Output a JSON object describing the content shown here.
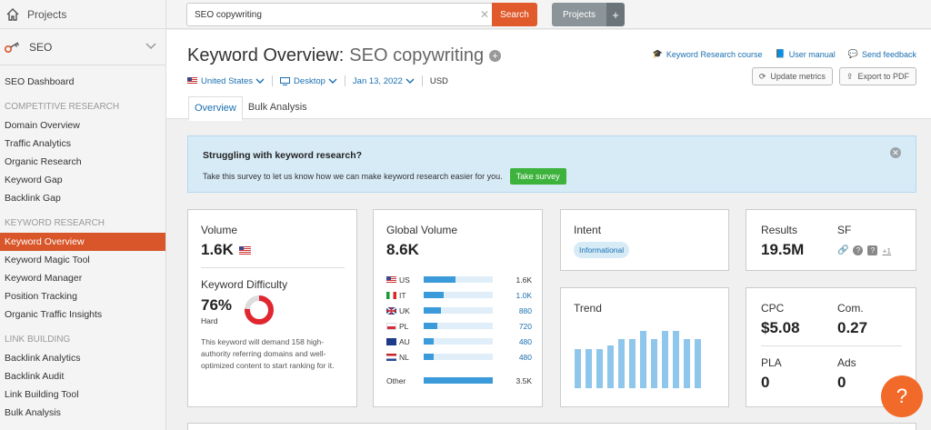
{
  "sidebar": {
    "projects_label": "Projects",
    "seo_label": "SEO",
    "dashboard": "SEO Dashboard",
    "sections": [
      {
        "heading": "COMPETITIVE RESEARCH",
        "items": [
          "Domain Overview",
          "Traffic Analytics",
          "Organic Research",
          "Keyword Gap",
          "Backlink Gap"
        ]
      },
      {
        "heading": "KEYWORD RESEARCH",
        "items": [
          "Keyword Overview",
          "Keyword Magic Tool",
          "Keyword Manager",
          "Position Tracking",
          "Organic Traffic Insights"
        ]
      },
      {
        "heading": "LINK BUILDING",
        "items": [
          "Backlink Analytics",
          "Backlink Audit",
          "Link Building Tool",
          "Bulk Analysis"
        ]
      }
    ]
  },
  "topbar": {
    "search_value": "SEO copywriting",
    "search_button": "Search",
    "projects_button": "Projects",
    "projects_plus": "+"
  },
  "header": {
    "title_prefix": "Keyword Overview:",
    "keyword": "SEO copywriting",
    "filters": {
      "country": "United States",
      "device": "Desktop",
      "date": "Jan 13, 2022",
      "currency": "USD"
    },
    "links": [
      "Keyword Research course",
      "User manual",
      "Send feedback"
    ],
    "buttons": [
      "Update metrics",
      "Export to PDF"
    ],
    "tabs": [
      "Overview",
      "Bulk Analysis"
    ]
  },
  "banner": {
    "title": "Struggling with keyword research?",
    "text": "Take this survey to let us know how we can make keyword research easier for you.",
    "button": "Take survey"
  },
  "volume": {
    "label": "Volume",
    "value": "1.6K",
    "kd_label": "Keyword Difficulty",
    "kd_value": "76%",
    "kd_level": "Hard",
    "kd_percent": 76,
    "kd_text": "This keyword will demand 158 high-authority referring domains and well-optimized content to start ranking for it."
  },
  "global_volume": {
    "label": "Global Volume",
    "value": "8.6K",
    "rows": [
      {
        "code": "US",
        "value": "1.6K",
        "share": 0.19
      },
      {
        "code": "IT",
        "value": "1.0K",
        "share": 0.12
      },
      {
        "code": "UK",
        "value": "880",
        "share": 0.1
      },
      {
        "code": "PL",
        "value": "720",
        "share": 0.08
      },
      {
        "code": "AU",
        "value": "480",
        "share": 0.06
      },
      {
        "code": "NL",
        "value": "480",
        "share": 0.06
      }
    ],
    "other_label": "Other",
    "other_value": "3.5K",
    "other_share": 0.41
  },
  "intent": {
    "label": "Intent",
    "badge": "Informational"
  },
  "trend": {
    "label": "Trend",
    "values": [
      0.62,
      0.62,
      0.62,
      0.67,
      0.77,
      0.77,
      0.9,
      0.77,
      0.9,
      0.9,
      0.77,
      0.77
    ]
  },
  "results": {
    "label": "Results",
    "value": "19.5M",
    "sf_label": "SF",
    "sf_more": "+1"
  },
  "cpc": {
    "cpc_label": "CPC",
    "cpc_value": "$5.08",
    "com_label": "Com.",
    "com_value": "0.27",
    "pla_label": "PLA",
    "pla_value": "0",
    "ads_label": "Ads",
    "ads_value": "0"
  },
  "help_button": "?",
  "colors": {
    "accent": "#d8562a",
    "link": "#1a6fb0",
    "bar": "#3b9ad9",
    "trend": "#8ec6ec",
    "kd": "#e0262f",
    "survey": "#3db33d"
  }
}
